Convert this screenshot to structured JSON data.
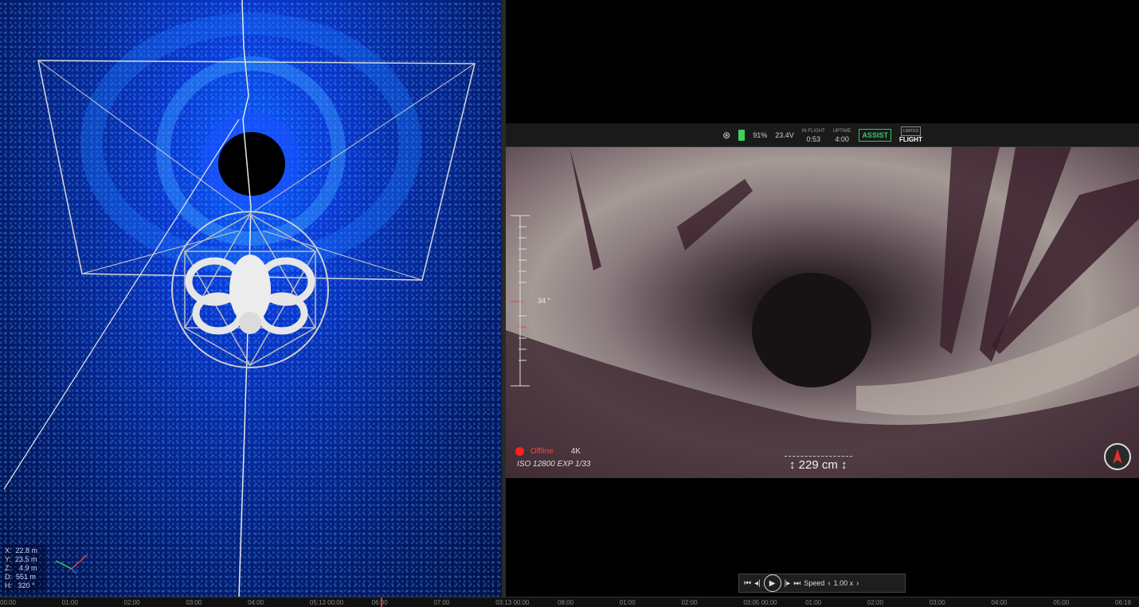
{
  "left_view": {
    "coords": {
      "x": "X:  22.8 m",
      "y": "Y:  23.5 m",
      "z": "Z:    4.9 m",
      "d": "D:  551 m",
      "h": "H:   320 °"
    },
    "icons": [
      "axes-gizmo-icon"
    ]
  },
  "hud": {
    "signal_icon": "signal-icon",
    "battery_percent": "91%",
    "voltage": "23.4V",
    "in_flight_label": "IN FLIGHT",
    "in_flight_value": "0:53",
    "uptime_label": "UPTIME",
    "uptime_value": "4:00",
    "assist_label": "ASSIST",
    "mode_box": "LIMITED",
    "mode_label": "FLIGHT"
  },
  "camera": {
    "pitch": "34 °",
    "rec_status": "Offline",
    "resolution": "4K",
    "exposure": "ISO 12800   EXP 1/33",
    "distance": "229 cm"
  },
  "playback": {
    "speed_label": "Speed",
    "speed_value": "1.00 x"
  },
  "timeline": {
    "ticks": [
      "00:00",
      "01:00",
      "02:00",
      "03:00",
      "04:00",
      "05:13 00:00",
      "06:00",
      "07:00",
      "03:13 00:00",
      "08:00",
      "01:00",
      "02:00",
      "03:05 00:00",
      "01:00",
      "02:00",
      "03:00",
      "04:00",
      "05:00",
      "06:18"
    ],
    "colors": {
      "marker": "#e03030"
    }
  },
  "colors": {
    "accent_green": "#36c46a",
    "rec_red": "#ff2020"
  }
}
